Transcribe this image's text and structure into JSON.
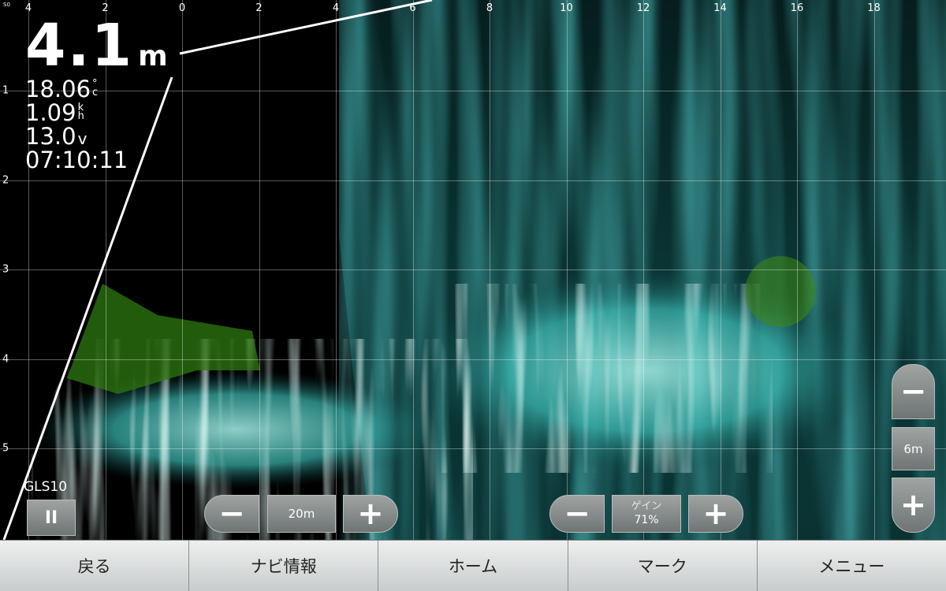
{
  "depth": {
    "value": "4.1",
    "unit": "m"
  },
  "water_temp": {
    "value": "18.06",
    "unit_top": "°",
    "unit_bottom": "c"
  },
  "speed": {
    "value": "1.09",
    "unit_top": "k",
    "unit_bottom": "h"
  },
  "voltage": {
    "value": "13.0",
    "unit": "v"
  },
  "clock": "07:10:11",
  "scale_unit": "S0",
  "top_scale": [
    "4",
    "2",
    "0",
    "2",
    "4",
    "6",
    "8",
    "10",
    "12",
    "14",
    "16",
    "18"
  ],
  "left_scale": [
    "1",
    "2",
    "3",
    "4",
    "5"
  ],
  "transducer_label": "GLS10",
  "pause_symbol": "II",
  "range_control": {
    "minus": "−",
    "value": "20m",
    "plus": "+"
  },
  "gain_control": {
    "minus": "−",
    "title": "ゲイン",
    "value": "71%",
    "plus": "+"
  },
  "depth_scale_control": {
    "minus": "−",
    "value": "6m",
    "plus": "+"
  },
  "bottom_menu": [
    "戻る",
    "ナビ情報",
    "ホーム",
    "マーク",
    "メニュー"
  ],
  "colors": {
    "echo_strong": "#eafffb",
    "echo_mid": "#2fb6b0",
    "echo_weak": "#0d4a4a",
    "echo_green": "#3f9a1a",
    "background": "#000000"
  }
}
